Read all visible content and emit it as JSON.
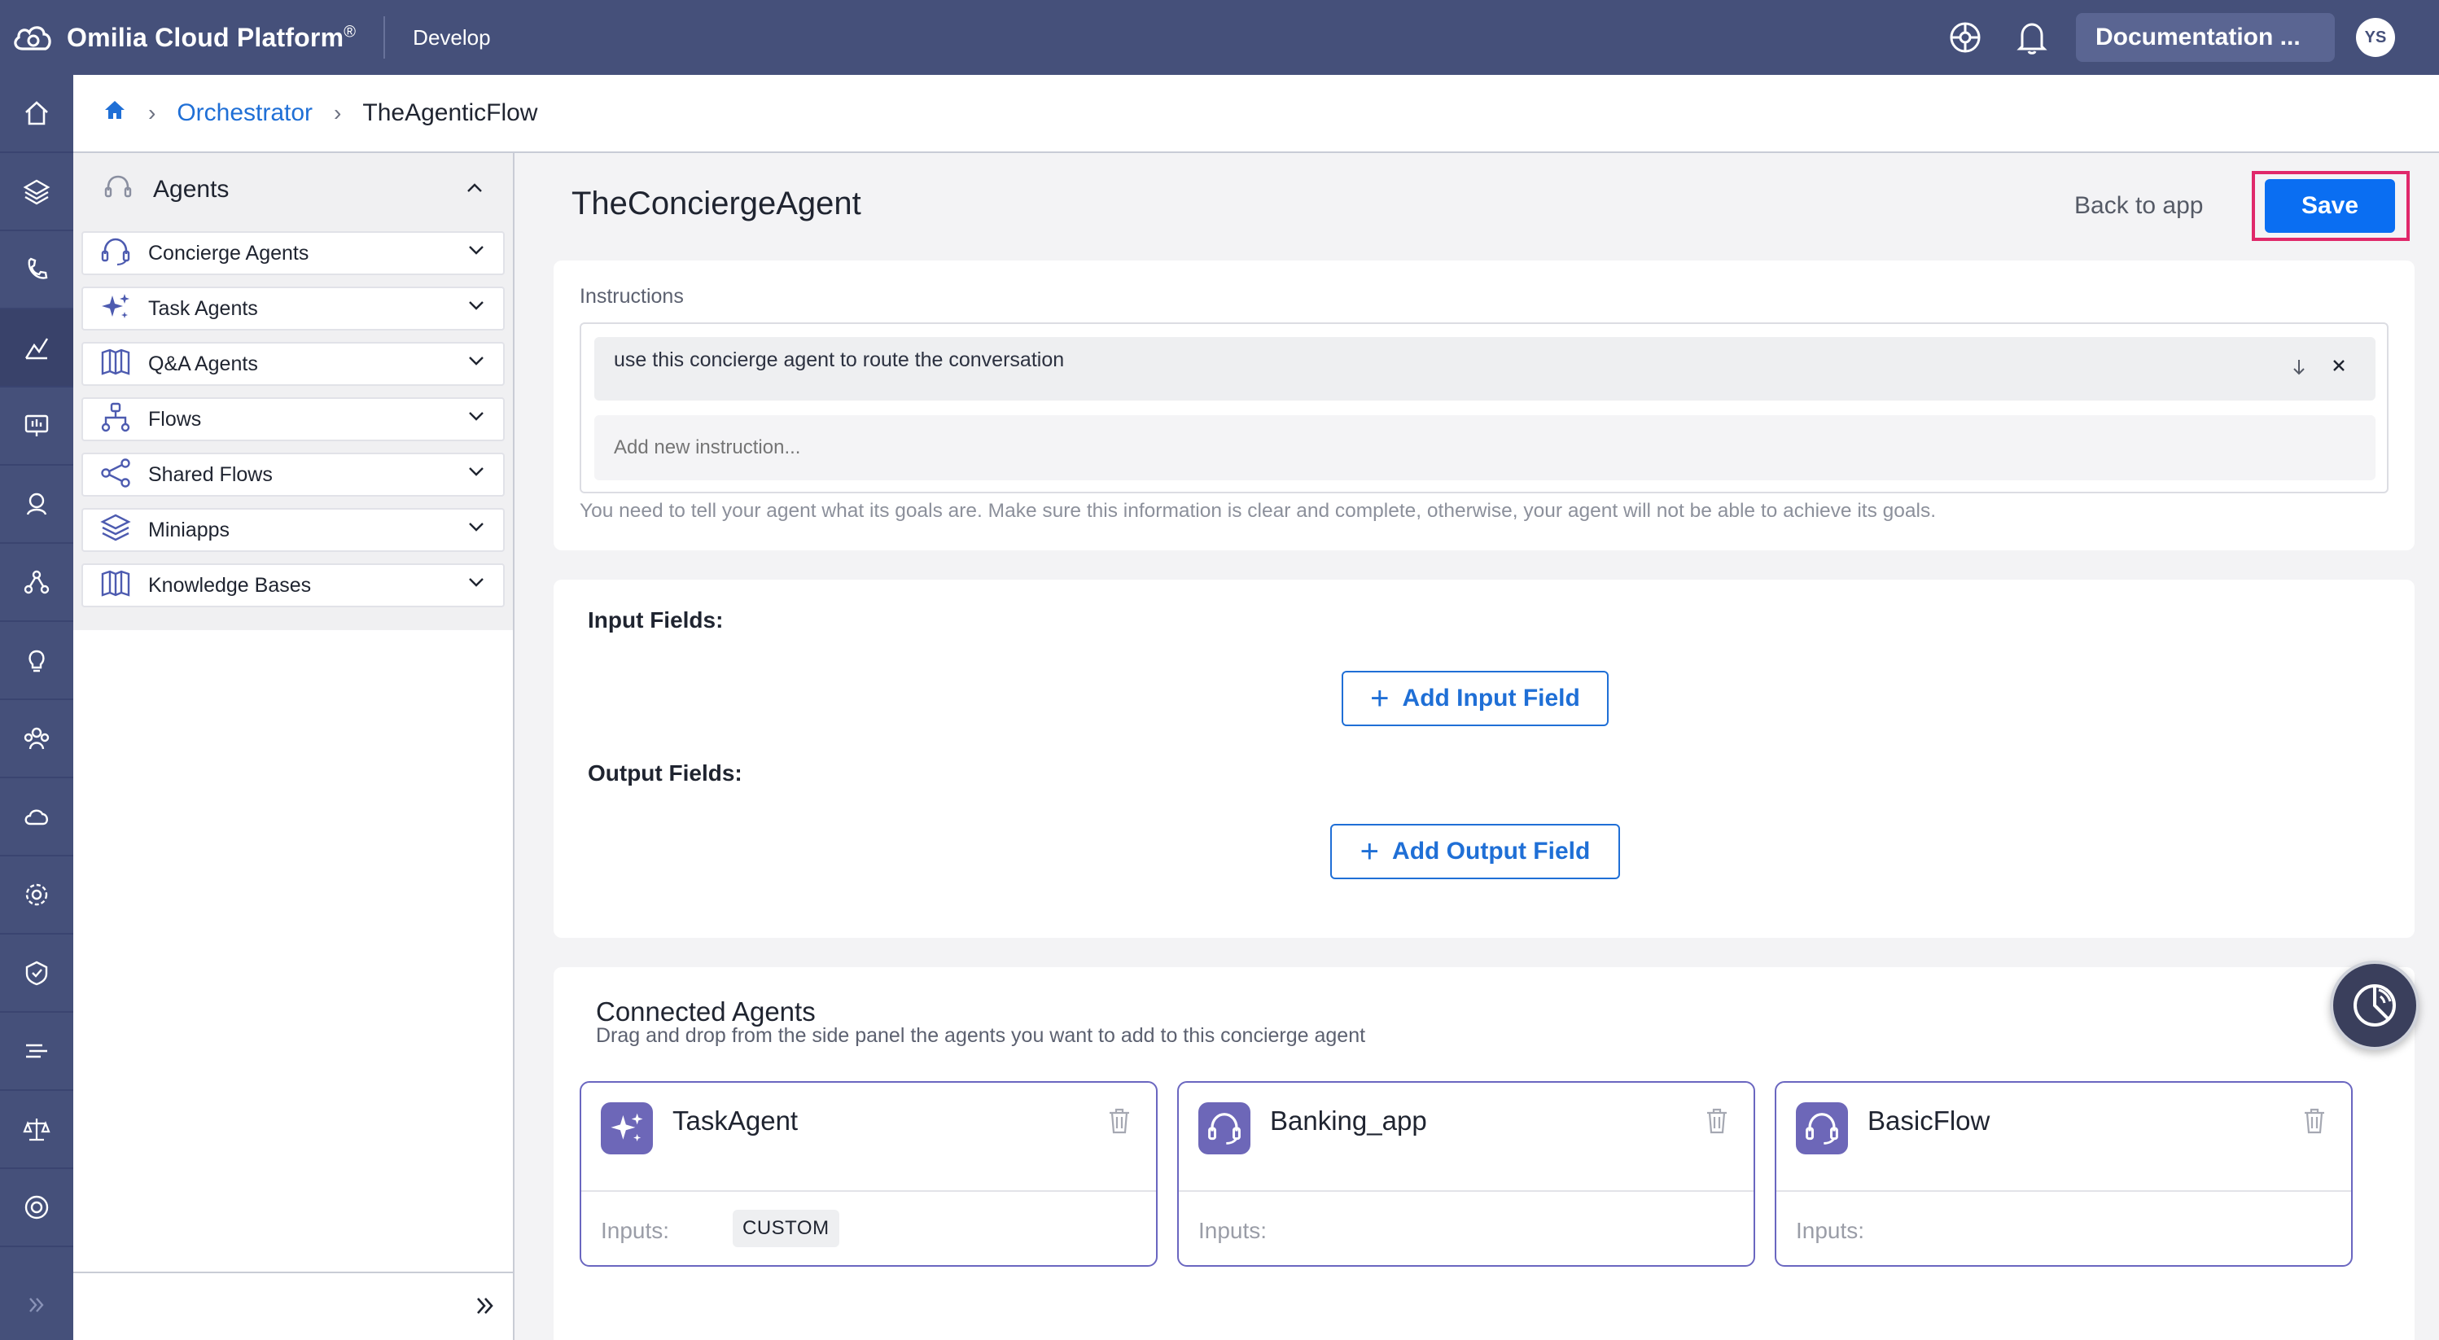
{
  "topbar": {
    "brand": "Omilia Cloud Platform",
    "brand_mark": "®",
    "section": "Develop",
    "documentation_label": "Documentation ...",
    "avatar_initials": "YS"
  },
  "breadcrumb": {
    "link": "Orchestrator",
    "current": "TheAgenticFlow"
  },
  "panel": {
    "title": "Agents",
    "items": [
      {
        "label": "Concierge Agents",
        "icon": "headset-icon"
      },
      {
        "label": "Task Agents",
        "icon": "sparkles-icon"
      },
      {
        "label": "Q&A Agents",
        "icon": "book-icon"
      },
      {
        "label": "Flows",
        "icon": "flow-icon"
      },
      {
        "label": "Shared Flows",
        "icon": "share-icon"
      },
      {
        "label": "Miniapps",
        "icon": "layers-icon"
      },
      {
        "label": "Knowledge Bases",
        "icon": "book-icon"
      }
    ]
  },
  "main": {
    "title": "TheConciergeAgent",
    "back_label": "Back to app",
    "save_label": "Save",
    "instructions": {
      "label": "Instructions",
      "items": [
        "use this concierge agent to route the conversation"
      ],
      "placeholder": "Add new instruction...",
      "help": "You need to tell your agent what its goals are. Make sure this information is clear and complete, otherwise, your agent will not be able to achieve its goals."
    },
    "fields": {
      "input_label": "Input Fields:",
      "add_input": "Add Input Field",
      "output_label": "Output Fields:",
      "add_output": "Add Output Field"
    },
    "connected": {
      "title": "Connected Agents",
      "subtitle": "Drag and drop from the side panel the agents you want to add to this concierge agent",
      "inputs_label": "Inputs:",
      "agents": [
        {
          "name": "TaskAgent",
          "icon": "sparkles-icon",
          "chip": "CUSTOM"
        },
        {
          "name": "Banking_app",
          "icon": "headset-icon",
          "chip": ""
        },
        {
          "name": "BasicFlow",
          "icon": "headset-icon",
          "chip": ""
        }
      ]
    }
  },
  "colors": {
    "topbar": "#45507a",
    "accent": "#0a6ef2",
    "highlight": "#e0286a",
    "agent_icon": "#6d67b8"
  }
}
